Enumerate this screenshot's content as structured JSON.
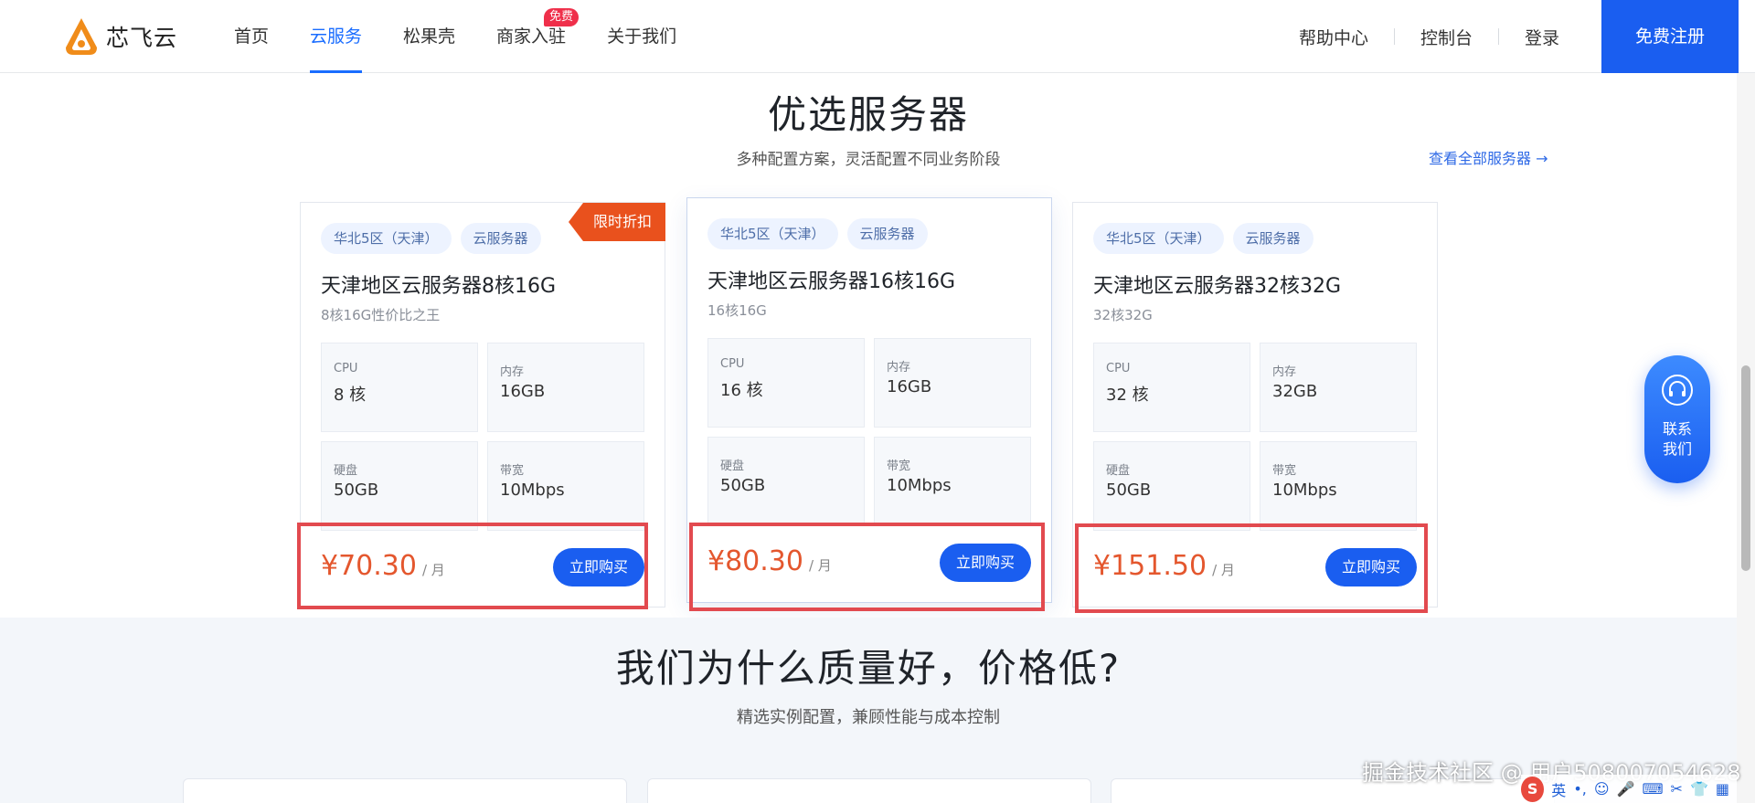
{
  "header": {
    "brand": "芯飞云",
    "nav": [
      {
        "label": "首页",
        "active": false
      },
      {
        "label": "云服务",
        "active": true
      },
      {
        "label": "松果壳",
        "active": false
      },
      {
        "label": "商家入驻",
        "active": false,
        "badge": "免费"
      },
      {
        "label": "关于我们",
        "active": false
      }
    ],
    "right_links": [
      "帮助中心",
      "控制台",
      "登录"
    ],
    "register": "免费注册"
  },
  "section": {
    "title": "优选服务器",
    "subtitle": "多种配置方案，灵活配置不同业务阶段",
    "view_all": "查看全部服务器 →"
  },
  "cards": [
    {
      "promo": "限时折扣",
      "tags": [
        "华北5区（天津）",
        "云服务器"
      ],
      "title": "天津地区云服务器8核16G",
      "desc": "8核16G性价比之王",
      "specs": [
        {
          "k": "CPU",
          "v": "8 核"
        },
        {
          "k": "内存",
          "v": "16GB"
        },
        {
          "k": "硬盘",
          "v": "50GB"
        },
        {
          "k": "带宽",
          "v": "10Mbps"
        }
      ],
      "price": "¥70.30",
      "unit": "/ 月",
      "buy": "立即购买"
    },
    {
      "promo": "",
      "tags": [
        "华北5区（天津）",
        "云服务器"
      ],
      "title": "天津地区云服务器16核16G",
      "desc": "16核16G",
      "specs": [
        {
          "k": "CPU",
          "v": "16 核"
        },
        {
          "k": "内存",
          "v": "16GB"
        },
        {
          "k": "硬盘",
          "v": "50GB"
        },
        {
          "k": "带宽",
          "v": "10Mbps"
        }
      ],
      "price": "¥80.30",
      "unit": "/ 月",
      "buy": "立即购买"
    },
    {
      "promo": "",
      "tags": [
        "华北5区（天津）",
        "云服务器"
      ],
      "title": "天津地区云服务器32核32G",
      "desc": "32核32G",
      "specs": [
        {
          "k": "CPU",
          "v": "32 核"
        },
        {
          "k": "内存",
          "v": "32GB"
        },
        {
          "k": "硬盘",
          "v": "50GB"
        },
        {
          "k": "带宽",
          "v": "10Mbps"
        }
      ],
      "price": "¥151.50",
      "unit": "/ 月",
      "buy": "立即购买"
    }
  ],
  "lower": {
    "title": "我们为什么质量好，价格低?",
    "subtitle": "精选实例配置，兼顾性能与成本控制"
  },
  "contact": {
    "line1": "联系",
    "line2": "我们"
  },
  "watermark": "掘金技术社区 @ 用户508007054628",
  "ime": {
    "logo": "S",
    "mode": "英"
  },
  "colors": {
    "primary": "#1a5ef0",
    "price": "#e4572e",
    "promo": "#e9511d",
    "highlight": "#e24a4f"
  }
}
